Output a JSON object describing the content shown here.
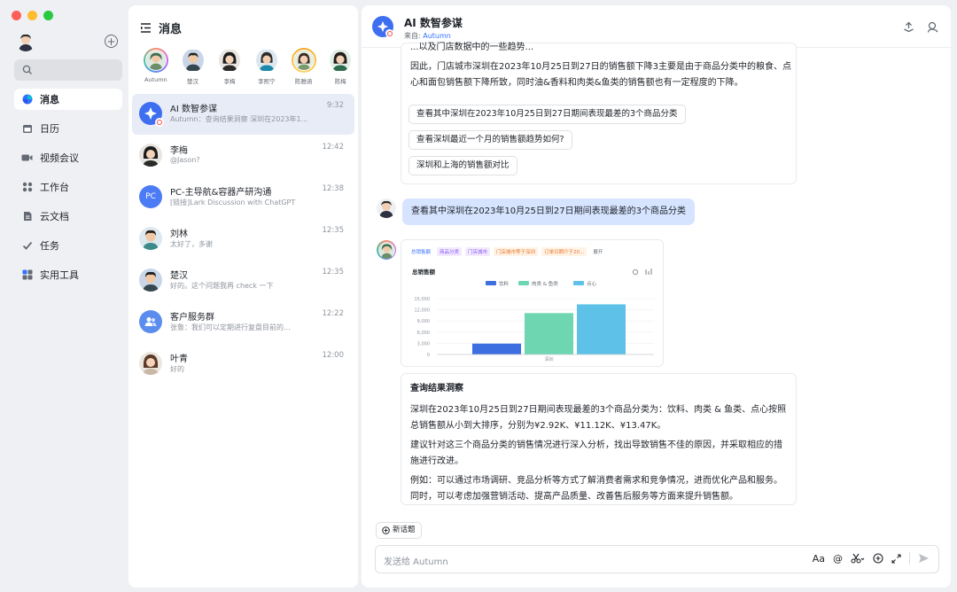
{
  "sidebar": {
    "nav": [
      {
        "label": "消息",
        "icon": "chat-bubble-icon",
        "active": true
      },
      {
        "label": "日历",
        "icon": "calendar-icon"
      },
      {
        "label": "视频会议",
        "icon": "video-camera-icon"
      },
      {
        "label": "工作台",
        "icon": "grid-apps-icon"
      },
      {
        "label": "云文档",
        "icon": "document-icon"
      },
      {
        "label": "任务",
        "icon": "checkmark-icon"
      },
      {
        "label": "实用工具",
        "icon": "tools-grid-icon"
      }
    ]
  },
  "messages": {
    "title": "消息",
    "contacts": [
      {
        "name": "Autumn",
        "ring": "#c56cf0"
      },
      {
        "name": "楚汉",
        "ring": ""
      },
      {
        "name": "李梅",
        "ring": ""
      },
      {
        "name": "李熙宁",
        "ring": ""
      },
      {
        "name": "陈雅涵",
        "ring": "#f5a623"
      },
      {
        "name": "陈梅",
        "ring": ""
      }
    ],
    "conversations": [
      {
        "name": "AI 数智参谋",
        "preview": "Autumn：查询结果洞察  深圳在2023年1...",
        "time": "9:32",
        "active": true
      },
      {
        "name": "李梅",
        "preview": "@Jason?",
        "time": "12:42"
      },
      {
        "name": "PC-主导航&容器产研沟通",
        "preview": "[链接]Lark Discussion with ChatGPT",
        "time": "12:38"
      },
      {
        "name": "刘林",
        "preview": "太好了，多谢",
        "time": "12:35"
      },
      {
        "name": "楚汉",
        "preview": "好的。这个问题我再 check 一下",
        "time": "12:35"
      },
      {
        "name": "客户服务群",
        "preview": "张鲁：我们可以定期进行复盘目前的...",
        "time": "12:22"
      },
      {
        "name": "叶青",
        "preview": "好的",
        "time": "12:00"
      }
    ]
  },
  "chat": {
    "title": "AI 数智参谋",
    "from_label": "来自:",
    "from_name": "Autumn",
    "partial_top": "...以及门店数据中的一些趋势...",
    "answer_text": "因此，门店城市深圳在2023年10月25日到27日的销售额下降3主要是由于商品分类中的粮食、点心和面包销售额下降所致，同时油&香料和肉类&鱼类的销售额也有一定程度的下降。",
    "suggestions": [
      "查看其中深圳在2023年10月25日到27日期间表现最差的3个商品分类",
      "查看深圳最近一个月的销售额趋势如何?",
      "深圳和上海的销售额对比"
    ],
    "user_message": "查看其中深圳在2023年10月25日到27日期间表现最差的3个商品分类",
    "filters": [
      "总销售额",
      "商品分类",
      "门店城市",
      "门店城市等于深圳",
      "订单日期介于20...",
      "展开"
    ],
    "insight": {
      "title": "查询结果洞察",
      "p1": "深圳在2023年10月25日到27日期间表现最差的3个商品分类为：饮料、肉类 & 鱼类、点心按照总销售额从小到大排序，分别为¥2.92K、¥11.12K、¥13.47K。",
      "p2": "建议针对这三个商品分类的销售情况进行深入分析，找出导致销售不佳的原因，并采取相应的措施进行改进。",
      "p3": "例如：可以通过市场调研、竞品分析等方式了解消费者需求和竞争情况，进而优化产品和服务。同时，可以考虑加强营销活动、提高产品质量、改善售后服务等方面来提升销售额。"
    },
    "new_topic": "新话题",
    "input_placeholder": "发送给 Autumn",
    "font_tool": "Aa"
  },
  "chart_data": {
    "type": "bar",
    "title": "总销售额",
    "categories": [
      "深圳"
    ],
    "series": [
      {
        "name": "饮料",
        "values": [
          2920
        ],
        "color": "#3e6fe0"
      },
      {
        "name": "肉类 & 鱼类",
        "values": [
          11120
        ],
        "color": "#6fd6b2"
      },
      {
        "name": "点心",
        "values": [
          13470
        ],
        "color": "#5ec1e8"
      }
    ],
    "ylim": [
      0,
      15000
    ],
    "yticks": [
      "15,000",
      "12,000",
      "9,000",
      "6,000",
      "3,000",
      "0"
    ],
    "grid": true,
    "legend": "top"
  }
}
